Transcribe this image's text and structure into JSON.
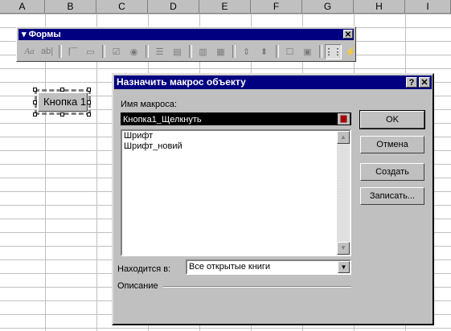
{
  "sheet": {
    "columns": [
      "A",
      "B",
      "C",
      "D",
      "E",
      "F",
      "G",
      "H",
      "I"
    ],
    "button_label": "Кнопка 1"
  },
  "toolbar": {
    "title": "Формы",
    "close": "✕",
    "icons": [
      "label-icon",
      "editbox-icon",
      "groupbox-icon",
      "button-icon",
      "checkbox-icon",
      "optionbutton-icon",
      "listbox-icon",
      "combobox-icon",
      "combolist-edit-icon",
      "combodropdown-edit-icon",
      "scrollbar-icon",
      "spinner-icon",
      "control-properties-icon",
      "edit-code-icon",
      "toggle-grid-icon",
      "run-dialog-icon"
    ]
  },
  "dialog": {
    "title": "Назначить макрос объекту",
    "help": "?",
    "close": "✕",
    "macro_name_label": "Имя макроса:",
    "macro_name_value": "Кнопка1_Щелкнуть",
    "macros": [
      "Шрифт",
      "Шрифт_новий"
    ],
    "location_label": "Находится в:",
    "location_value": "Все открытые книги",
    "description_label": "Описание",
    "buttons": {
      "ok": "OK",
      "cancel": "Отмена",
      "create": "Создать",
      "record": "Записать..."
    }
  }
}
